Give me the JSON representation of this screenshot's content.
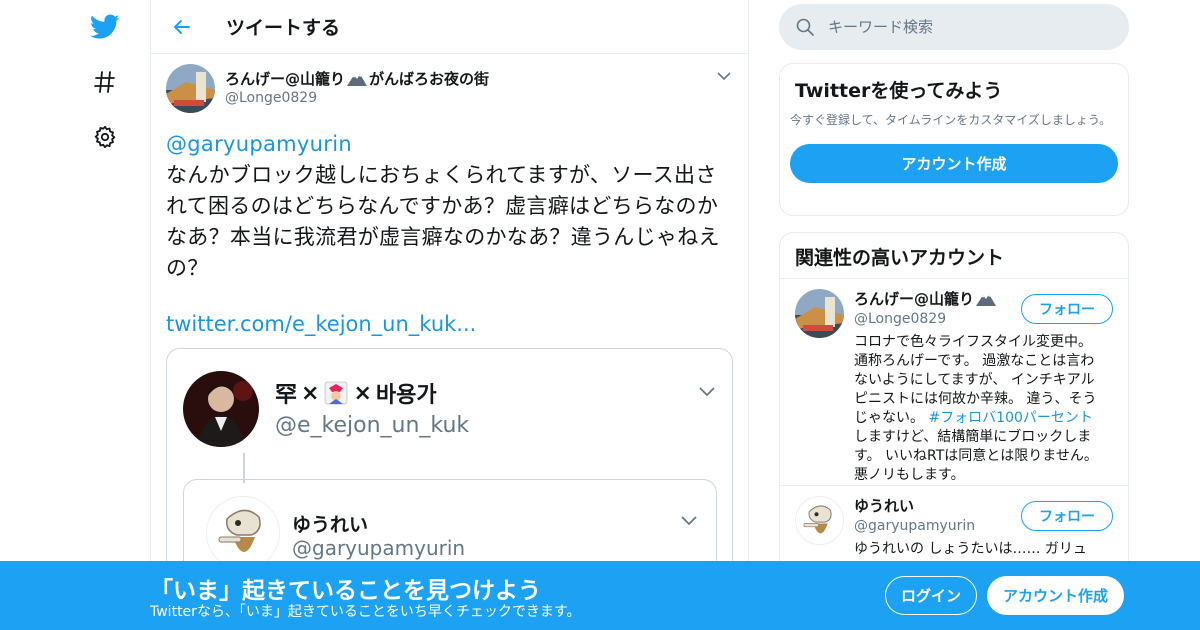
{
  "nav": {
    "logo_icon": "twitter-bird-icon",
    "explore_icon": "hashtag-icon",
    "settings_icon": "gear-icon"
  },
  "header": {
    "back_icon": "back-arrow-icon",
    "title": "ツイートする"
  },
  "tweet": {
    "author_name": "ろんげー@山籠り",
    "author_name_suffix": "がんばろお夜の街",
    "author_handle": "@Longe0829",
    "mention": "@garyupamyurin",
    "text": "なんかブロック越しにおちょくられてますが、ソース出されて困るのはどちらなんですかあ？虚言癖はどちらなのかなあ？本当に我流君が虚言癖なのかなあ？違うんじゃねえの？",
    "link": "twitter.com/e_kejon_un_kuk...",
    "quote": {
      "name_left": "罕",
      "name_sep": "×",
      "name_right": "바용가",
      "handle": "@e_kejon_un_kuk",
      "inner": {
        "name": "ゆうれい",
        "handle": "@garyupamyurin"
      }
    }
  },
  "search": {
    "placeholder": "キーワード検索"
  },
  "signup_card": {
    "title": "Twitterを使ってみよう",
    "description": "今すぐ登録して、タイムラインをカスタマイズしましょう。",
    "button": "アカウント作成"
  },
  "related": {
    "title": "関連性の高いアカウント",
    "accounts": [
      {
        "name": "ろんげー@山籠り",
        "handle": "@Longe0829",
        "follow": "フォロー",
        "bio_before": "コロナで色々ライフスタイル変更中。通称ろんげーです。 過激なことは言わないようにしてますが、 インチキアルピニストには何故か辛辣。 違う、そうじゃない。 ",
        "bio_tag": "#フォロバ100パーセント",
        "bio_after": " しますけど、結構簡単にブロックします。 いいねRTは同意とは限りません。 悪ノリもします。"
      },
      {
        "name": "ゆうれい",
        "handle": "@garyupamyurin",
        "follow": "フォロー",
        "bio_before": "ゆうれいの しょうたいは…… ガリュ"
      }
    ]
  },
  "bottom_bar": {
    "title": "「いま」起きていることを見つけよう",
    "subtitle": "Twitterなら、「いま」起きていることをいち早くチェックできます。",
    "login": "ログイン",
    "signup": "アカウント作成"
  },
  "colors": {
    "brand": "#1da1f2",
    "link": "#1b95e0",
    "muted": "#657786",
    "border": "#e6ecf0"
  }
}
